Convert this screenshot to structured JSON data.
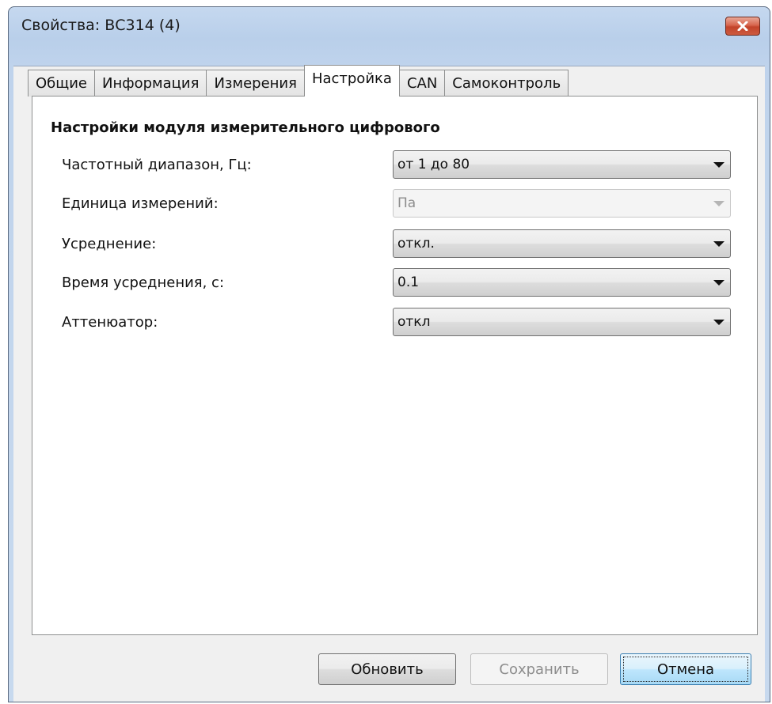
{
  "window": {
    "title": "Свойства: ВС314 (4)"
  },
  "tabs": [
    {
      "label": "Общие",
      "active": false
    },
    {
      "label": "Информация",
      "active": false
    },
    {
      "label": "Измерения",
      "active": false
    },
    {
      "label": "Настройка",
      "active": true
    },
    {
      "label": "CAN",
      "active": false
    },
    {
      "label": "Самоконтроль",
      "active": false
    }
  ],
  "settings": {
    "group_title": "Настройки модуля измерительного цифрового",
    "rows": [
      {
        "label": "Частотный диапазон, Гц:",
        "value": "от 1 до 80",
        "enabled": true
      },
      {
        "label": "Единица измерений:",
        "value": "Па",
        "enabled": false
      },
      {
        "label": "Усреднение:",
        "value": "откл.",
        "enabled": true
      },
      {
        "label": "Время усреднения, с:",
        "value": "0.1",
        "enabled": true
      },
      {
        "label": "Аттенюатор:",
        "value": "откл",
        "enabled": true
      }
    ]
  },
  "buttons": {
    "refresh_label": "Обновить",
    "save_label": "Сохранить",
    "cancel_label": "Отмена"
  },
  "colors": {
    "titlebar": "#b9cfea",
    "close_button": "#c2432a",
    "client_bg": "#f0f0f0",
    "default_button": "#bee6fd"
  }
}
